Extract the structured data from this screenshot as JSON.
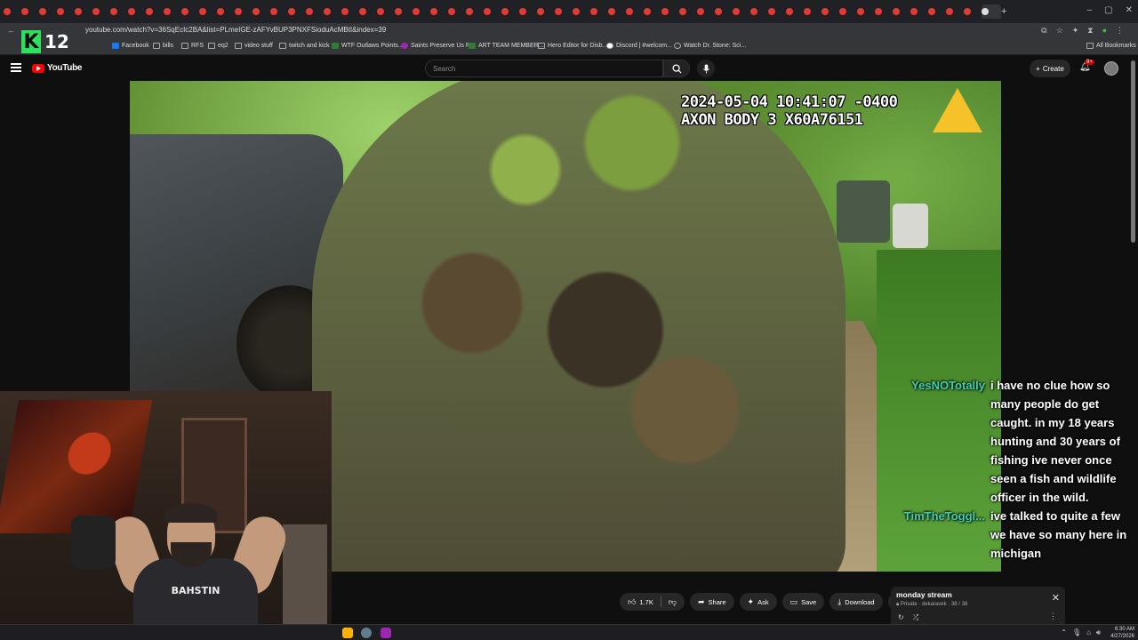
{
  "browser": {
    "url": "youtube.com/watch?v=36SqEcIc2BA&list=PLmeIGE-zAFYvBUP3PNXFSioduAcMBtI&index=39",
    "bookmarks": [
      "Facebook",
      "bills",
      "RFS",
      "eq2",
      "video stuff",
      "twitch and kick",
      "WTF Outlaws Points...",
      "Saints Preserve Us R...",
      "ART TEAM MEMBER...",
      "Hero Editor for Disb...",
      "Discord | #welcom...",
      "Watch Dr. Stone: Sci...",
      "All Bookmarks"
    ]
  },
  "overlay": {
    "logo_letter": "K",
    "logo_number": "12"
  },
  "youtube": {
    "logo_text": "YouTube",
    "search_placeholder": "Search",
    "create_label": "Create",
    "notification_count": "9+"
  },
  "video": {
    "timestamp_line1": "2024-05-04 10:41:07 -0400",
    "timestamp_line2": "AXON BODY 3 X60A76151"
  },
  "chat": [
    {
      "user": "YesNOTotally",
      "message": "i have no clue how so many people do get caught. in my 18 years hunting and 30 years of fishing ive never once seen a fish and wildlife officer in the wild."
    },
    {
      "user": "TimTheToggl...",
      "message": "ive talked to quite a few we have so many here in michigan"
    }
  ],
  "webcam": {
    "shirt_text": "BAHSTIN"
  },
  "actions": {
    "like_count": "1.7K",
    "share": "Share",
    "ask": "Ask",
    "save": "Save",
    "download": "Download"
  },
  "playlist": {
    "title": "monday stream",
    "privacy": "Private",
    "owner": "dekaravek",
    "position": "38 / 38"
  },
  "taskbar": {
    "time": "6:30 AM",
    "date": "4/27/2026"
  }
}
